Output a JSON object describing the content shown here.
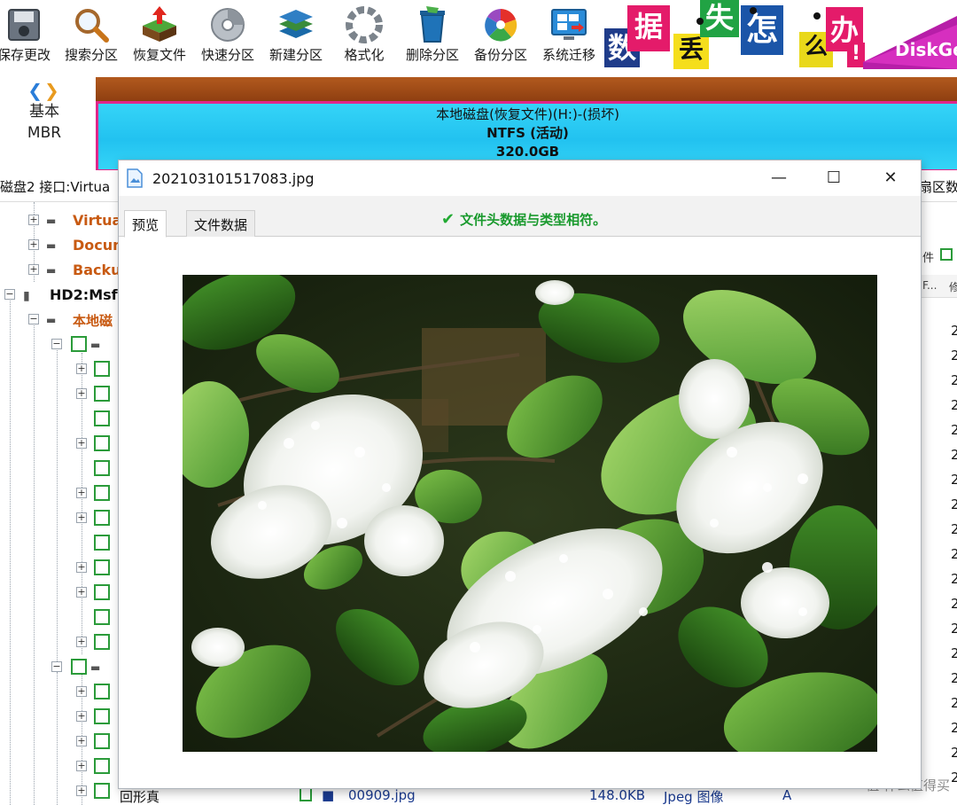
{
  "toolbar": {
    "buttons": [
      {
        "label": "保存更改",
        "icon": "save-icon"
      },
      {
        "label": "搜索分区",
        "icon": "search-partition-icon"
      },
      {
        "label": "恢复文件",
        "icon": "recover-file-icon"
      },
      {
        "label": "快速分区",
        "icon": "quick-partition-icon"
      },
      {
        "label": "新建分区",
        "icon": "new-partition-icon"
      },
      {
        "label": "格式化",
        "icon": "format-icon"
      },
      {
        "label": "删除分区",
        "icon": "delete-partition-icon"
      },
      {
        "label": "备份分区",
        "icon": "backup-partition-icon"
      },
      {
        "label": "系统迁移",
        "icon": "system-migrate-icon"
      }
    ]
  },
  "banner": {
    "chars": [
      "数",
      "据",
      "丢",
      "失",
      "怎",
      "么",
      "办"
    ],
    "exclaim": "!",
    "brand": "DiskGe"
  },
  "disk_nav": {
    "type": "基本",
    "scheme": "MBR"
  },
  "partition": {
    "title": "本地磁盘(恢复文件)(H:)-(损坏)",
    "fs": "NTFS (活动)",
    "size": "320.0GB"
  },
  "info_bar": {
    "text": "磁盘2 接口:Virtua",
    "right_text": "扇区数"
  },
  "tree": {
    "items": [
      {
        "label": "Virtua",
        "color": "#c85a12"
      },
      {
        "label": "Docum",
        "color": "#c85a12"
      },
      {
        "label": "Backu",
        "color": "#c85a12"
      },
      {
        "label": "HD2:Msf",
        "color": "#111111"
      },
      {
        "label": "本地磁",
        "color": "#c85a12"
      },
      {
        "label": "回形真",
        "color": "#111111"
      }
    ]
  },
  "right_list": {
    "head_cut": "件",
    "col1": "F...",
    "col2": "修",
    "row_digit": "2"
  },
  "bottom_row": {
    "filename": "00909.jpg",
    "size": "148.0KB",
    "type": "Jpeg 图像",
    "attr": "A",
    "name_short": "00909.jpg"
  },
  "watermark": "值 什么值得买",
  "dialog": {
    "title": "202103101517083.jpg",
    "tabs": [
      "预览",
      "文件数据"
    ],
    "status": "文件头数据与类型相符。",
    "buttons": {
      "minimize": "—",
      "maximize": "☐",
      "close": "✕"
    }
  },
  "colors": {
    "accent_orange": "#c85a12",
    "status_green": "#1a9a2e",
    "partition_cyan": "#22c2f0",
    "partition_border": "#e0268a"
  }
}
